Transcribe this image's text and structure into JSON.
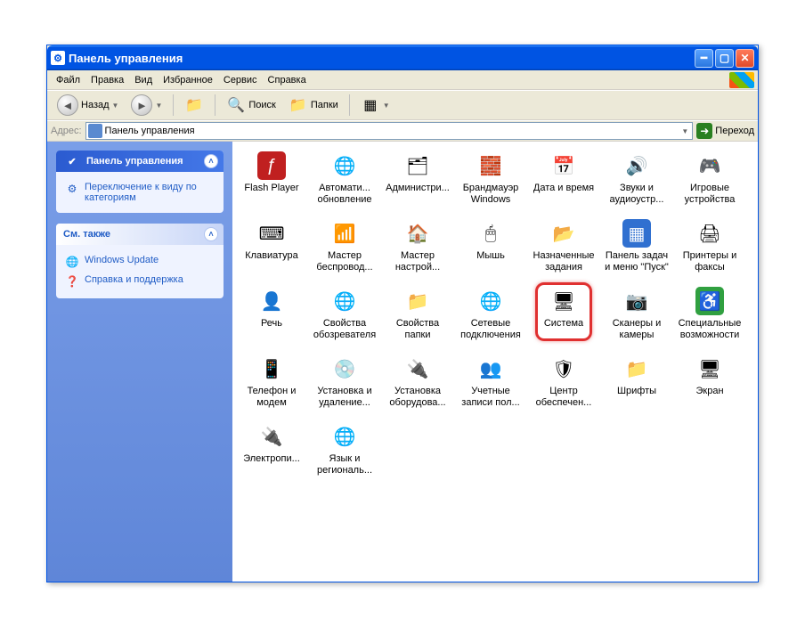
{
  "window": {
    "title": "Панель управления"
  },
  "menu": [
    "Файл",
    "Правка",
    "Вид",
    "Избранное",
    "Сервис",
    "Справка"
  ],
  "toolbar": {
    "back": "Назад",
    "search": "Поиск",
    "folders": "Папки"
  },
  "address": {
    "label": "Адрес:",
    "value": "Панель управления",
    "go": "Переход"
  },
  "sidebar": {
    "panel1": {
      "title": "Панель управления",
      "link1": "Переключение к виду по категориям"
    },
    "panel2": {
      "title": "См. также",
      "link1": "Windows Update",
      "link2": "Справка и поддержка"
    }
  },
  "items": [
    {
      "label": "Flash Player",
      "icon": "flash-icon",
      "glyph": "ƒ",
      "bg": "#c02020",
      "fg": "#fff"
    },
    {
      "label": "Автомати...\nобновление",
      "icon": "autoupdate-icon",
      "glyph": "🌐",
      "bg": "",
      "fg": ""
    },
    {
      "label": "Администри...",
      "icon": "admin-icon",
      "glyph": "🗂",
      "bg": "",
      "fg": ""
    },
    {
      "label": "Брандмауэр Windows",
      "icon": "firewall-icon",
      "glyph": "🧱",
      "bg": "",
      "fg": ""
    },
    {
      "label": "Дата и время",
      "icon": "datetime-icon",
      "glyph": "📅",
      "bg": "",
      "fg": ""
    },
    {
      "label": "Звуки и аудиоустр...",
      "icon": "sounds-icon",
      "glyph": "🔊",
      "bg": "",
      "fg": ""
    },
    {
      "label": "Игровые устройства",
      "icon": "gamectrl-icon",
      "glyph": "🎮",
      "bg": "",
      "fg": ""
    },
    {
      "label": "Клавиатура",
      "icon": "keyboard-icon",
      "glyph": "⌨",
      "bg": "",
      "fg": ""
    },
    {
      "label": "Мастер беспровод...",
      "icon": "wireless-icon",
      "glyph": "📶",
      "bg": "",
      "fg": ""
    },
    {
      "label": "Мастер настрой...",
      "icon": "networkwiz-icon",
      "glyph": "🏠",
      "bg": "",
      "fg": ""
    },
    {
      "label": "Мышь",
      "icon": "mouse-icon",
      "glyph": "🖱",
      "bg": "",
      "fg": ""
    },
    {
      "label": "Назначенные задания",
      "icon": "tasks-icon",
      "glyph": "📂",
      "bg": "",
      "fg": ""
    },
    {
      "label": "Панель задач и меню \"Пуск\"",
      "icon": "taskbar-icon",
      "glyph": "▦",
      "bg": "#3070d0",
      "fg": "#fff"
    },
    {
      "label": "Принтеры и факсы",
      "icon": "printers-icon",
      "glyph": "🖨",
      "bg": "",
      "fg": ""
    },
    {
      "label": "Речь",
      "icon": "speech-icon",
      "glyph": "👤",
      "bg": "",
      "fg": ""
    },
    {
      "label": "Свойства обозревателя",
      "icon": "inetopt-icon",
      "glyph": "🌐",
      "bg": "",
      "fg": ""
    },
    {
      "label": "Свойства папки",
      "icon": "folderopt-icon",
      "glyph": "📁",
      "bg": "",
      "fg": ""
    },
    {
      "label": "Сетевые подключения",
      "icon": "netconn-icon",
      "glyph": "🌐",
      "bg": "",
      "fg": ""
    },
    {
      "label": "Система",
      "icon": "system-icon",
      "glyph": "🖥",
      "bg": "",
      "fg": "",
      "highlighted": true
    },
    {
      "label": "Сканеры и камеры",
      "icon": "scanners-icon",
      "glyph": "📷",
      "bg": "",
      "fg": ""
    },
    {
      "label": "Специальные возможности",
      "icon": "access-icon",
      "glyph": "♿",
      "bg": "#30a040",
      "fg": "#fff"
    },
    {
      "label": "Телефон и модем",
      "icon": "phone-icon",
      "glyph": "📱",
      "bg": "",
      "fg": ""
    },
    {
      "label": "Установка и удаление...",
      "icon": "addremove-icon",
      "glyph": "💿",
      "bg": "",
      "fg": ""
    },
    {
      "label": "Установка оборудова...",
      "icon": "addhw-icon",
      "glyph": "🔌",
      "bg": "",
      "fg": ""
    },
    {
      "label": "Учетные записи пол...",
      "icon": "users-icon",
      "glyph": "👥",
      "bg": "",
      "fg": ""
    },
    {
      "label": "Центр обеспечен...",
      "icon": "security-icon",
      "glyph": "🛡",
      "bg": "",
      "fg": ""
    },
    {
      "label": "Шрифты",
      "icon": "fonts-icon",
      "glyph": "📁",
      "bg": "",
      "fg": ""
    },
    {
      "label": "Экран",
      "icon": "display-icon",
      "glyph": "🖥",
      "bg": "",
      "fg": ""
    },
    {
      "label": "Электропи...",
      "icon": "power-icon",
      "glyph": "🔌",
      "bg": "",
      "fg": ""
    },
    {
      "label": "Язык и региональ...",
      "icon": "regional-icon",
      "glyph": "🌐",
      "bg": "",
      "fg": ""
    }
  ]
}
